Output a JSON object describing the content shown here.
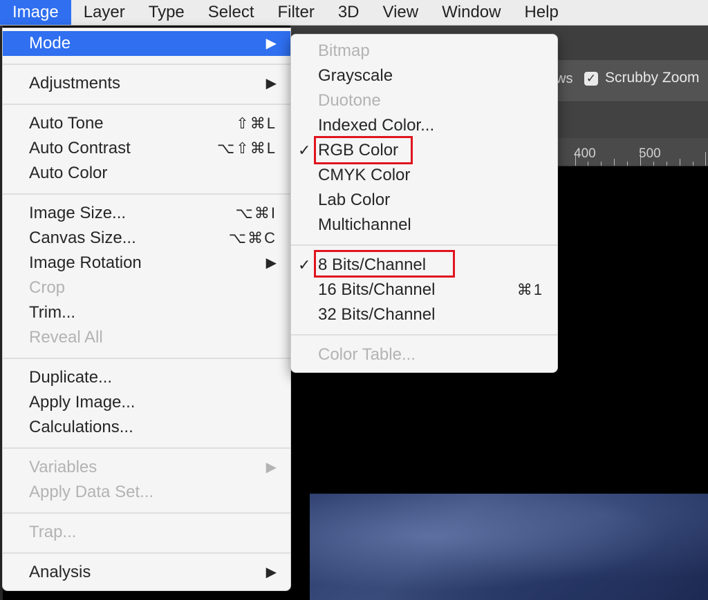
{
  "menubar": {
    "items": [
      {
        "label": "Image",
        "active": true
      },
      {
        "label": "Layer"
      },
      {
        "label": "Type"
      },
      {
        "label": "Select"
      },
      {
        "label": "Filter"
      },
      {
        "label": "3D"
      },
      {
        "label": "View"
      },
      {
        "label": "Window"
      },
      {
        "label": "Help"
      }
    ]
  },
  "options_bar": {
    "partial_text": "ws",
    "scrubby_zoom": {
      "label": "Scrubby Zoom",
      "checked": true
    }
  },
  "ruler": {
    "labels": [
      "400",
      "500"
    ]
  },
  "image_menu": {
    "items": [
      {
        "label": "Mode",
        "submenu": true,
        "selected": true
      },
      {
        "label": "Adjustments",
        "submenu": true
      },
      {
        "label": "Auto Tone",
        "shortcut": "⇧⌘L"
      },
      {
        "label": "Auto Contrast",
        "shortcut": "⌥⇧⌘L"
      },
      {
        "label": "Auto Color"
      },
      {
        "label": "Image Size...",
        "shortcut": "⌥⌘I"
      },
      {
        "label": "Canvas Size...",
        "shortcut": "⌥⌘C"
      },
      {
        "label": "Image Rotation",
        "submenu": true
      },
      {
        "label": "Crop",
        "disabled": true
      },
      {
        "label": "Trim..."
      },
      {
        "label": "Reveal All",
        "disabled": true
      },
      {
        "label": "Duplicate..."
      },
      {
        "label": "Apply Image..."
      },
      {
        "label": "Calculations..."
      },
      {
        "label": "Variables",
        "submenu": true,
        "disabled": true
      },
      {
        "label": "Apply Data Set...",
        "disabled": true
      },
      {
        "label": "Trap...",
        "disabled": true
      },
      {
        "label": "Analysis",
        "submenu": true
      }
    ]
  },
  "mode_menu": {
    "items": [
      {
        "label": "Bitmap",
        "disabled": true
      },
      {
        "label": "Grayscale"
      },
      {
        "label": "Duotone",
        "disabled": true
      },
      {
        "label": "Indexed Color..."
      },
      {
        "label": "RGB Color",
        "checked": true,
        "highlighted": true
      },
      {
        "label": "CMYK Color"
      },
      {
        "label": "Lab Color"
      },
      {
        "label": "Multichannel"
      },
      {
        "label": "8 Bits/Channel",
        "checked": true,
        "highlighted": true
      },
      {
        "label": "16 Bits/Channel",
        "shortcut": "⌘1"
      },
      {
        "label": "32 Bits/Channel"
      },
      {
        "label": "Color Table...",
        "disabled": true
      }
    ]
  },
  "glyphs": {
    "submenu_arrow": "▶",
    "checkmark": "✓",
    "checkbox_check": "✓"
  },
  "colors": {
    "menu_highlight": "#2f6ff0",
    "annotation_red": "#e0141e"
  }
}
